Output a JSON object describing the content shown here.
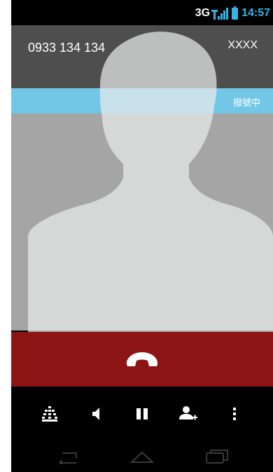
{
  "status_bar": {
    "network_type": "3G",
    "time": "14:57",
    "icons": [
      "signal-icon",
      "battery-icon"
    ]
  },
  "caller": {
    "phone_number": "0933 134 134",
    "name": "XXXX",
    "call_status": "撥號中"
  },
  "end_call": {
    "icon": "hang-up-icon"
  },
  "call_controls": [
    {
      "icon": "dialpad-icon"
    },
    {
      "icon": "speaker-icon"
    },
    {
      "icon": "hold-icon"
    },
    {
      "icon": "add-call-icon"
    },
    {
      "icon": "overflow-menu-icon"
    }
  ],
  "nav_bar": [
    {
      "icon": "back-icon"
    },
    {
      "icon": "home-icon"
    },
    {
      "icon": "recent-apps-icon"
    }
  ],
  "colors": {
    "accent": "#33b5e5",
    "caller_band": "#4e4e4e",
    "status_band": "#72c7e7",
    "end_band": "#8c1414",
    "photo_background": "#a5a5a5"
  }
}
